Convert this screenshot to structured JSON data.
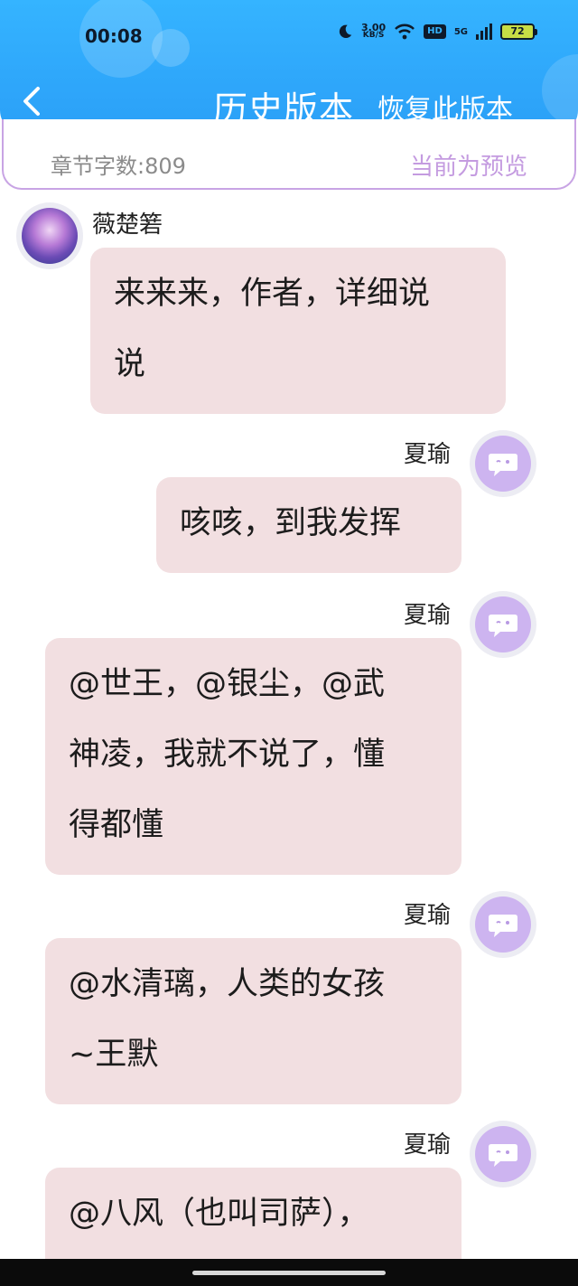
{
  "status_bar": {
    "time": "00:08",
    "net_speed_value": "3.00",
    "net_speed_unit": "KB/S",
    "hd": "HD",
    "network": "5G",
    "battery": "72"
  },
  "header": {
    "title": "历史版本",
    "restore_label": "恢复此版本",
    "back_icon": "chevron-left-icon"
  },
  "info": {
    "word_count": "章节字数:809",
    "preview_status": "当前为预览"
  },
  "messages": [
    {
      "sender": "薇楚箬",
      "side": "left",
      "lines": [
        "来来来，作者，详细说",
        "说"
      ]
    },
    {
      "sender": "夏瑜",
      "side": "right",
      "lines": [
        "咳咳，到我发挥"
      ]
    },
    {
      "sender": "夏瑜",
      "side": "right",
      "lines": [
        "@世王，@银尘，@武",
        "神凌，我就不说了，懂",
        "得都懂"
      ]
    },
    {
      "sender": "夏瑜",
      "side": "right",
      "lines": [
        "@水清璃，人类的女孩",
        "~王默"
      ]
    },
    {
      "sender": "夏瑜",
      "side": "right",
      "lines": [
        "@八风（也叫司萨），"
      ]
    }
  ],
  "colors": {
    "header_blue": "#2fa8fb",
    "bubble_pink": "#f2dfe1",
    "accent_purple": "#c49be0"
  }
}
